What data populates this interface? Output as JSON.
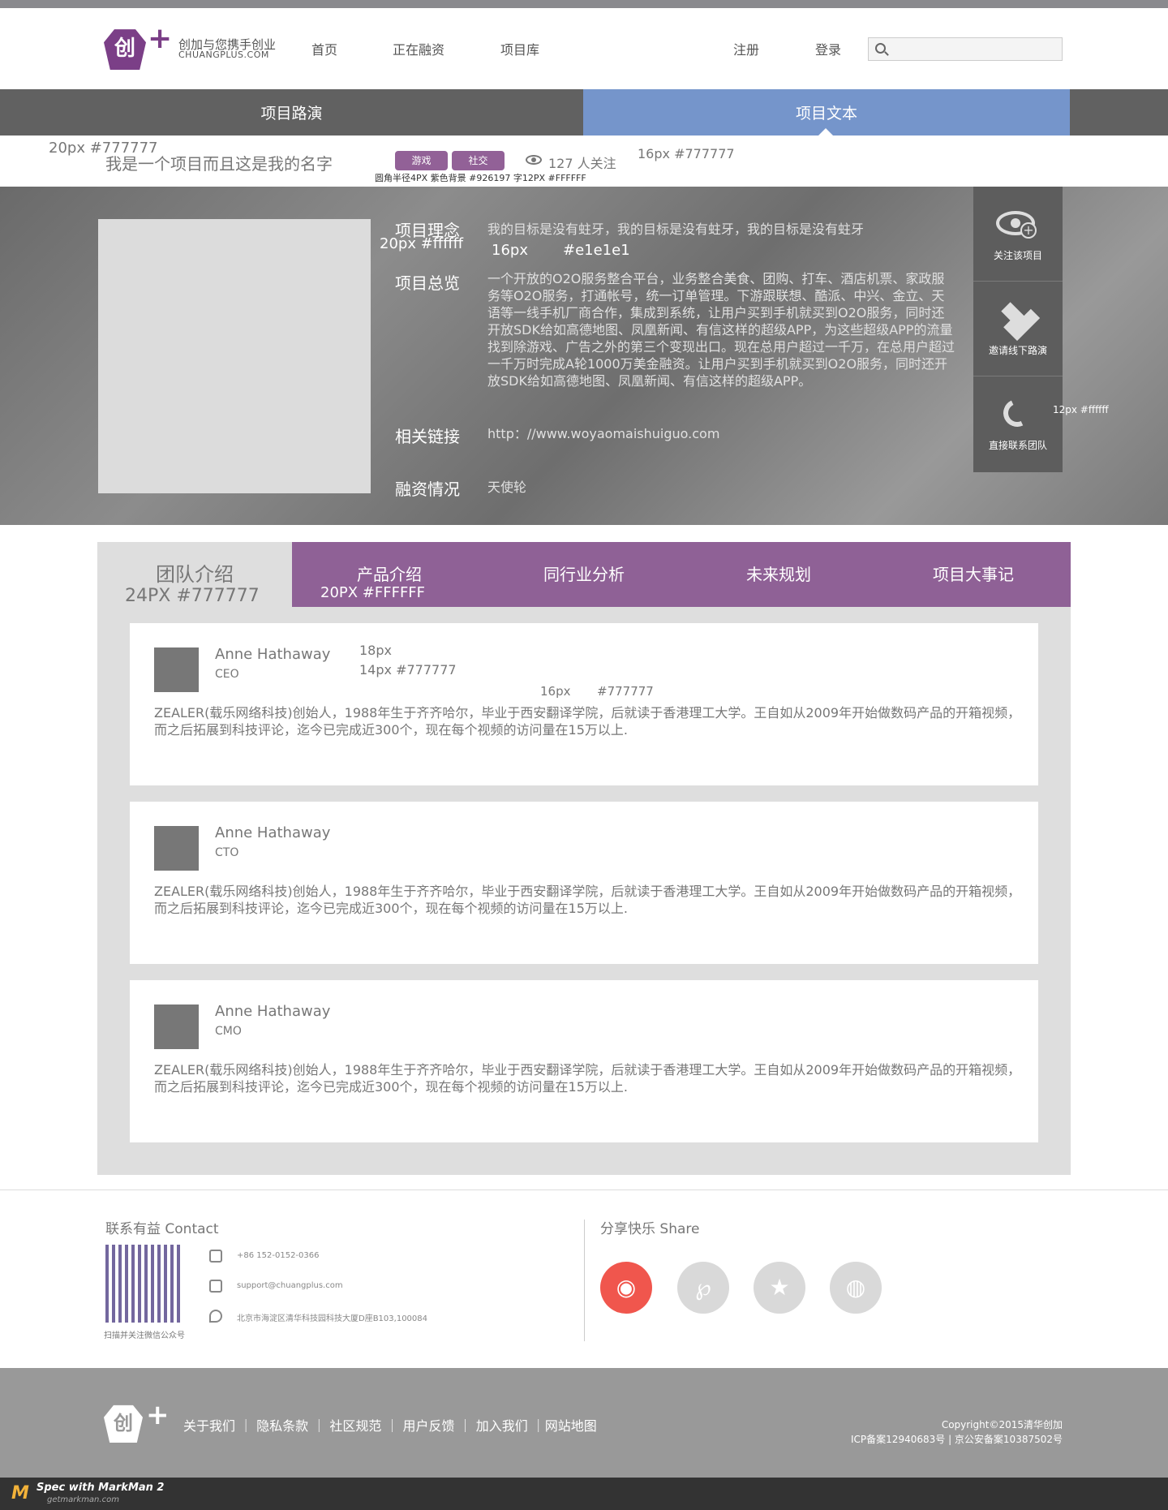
{
  "header": {
    "logo_mark": "创",
    "logo_plus": "+",
    "tagline_cn": "创加与您携手创业",
    "tagline_en": "CHUANGPLUS.COM",
    "nav": [
      "首页",
      "正在融资",
      "项目库"
    ],
    "register": "注册",
    "login": "登录",
    "search_placeholder": ""
  },
  "tabs": {
    "roadshow": "项目路演",
    "text": "项目文本"
  },
  "project": {
    "name": "我是一个项目而且这是我的名字",
    "tags": [
      "游戏",
      "社交"
    ],
    "followers": "127 人关注"
  },
  "hero": {
    "labels": [
      "项目理念",
      "项目总览",
      "相关链接",
      "融资情况"
    ],
    "idea": "我的目标是没有蛀牙，我的目标是没有蛀牙，我的目标是没有蛀牙",
    "overview": "一个开放的O2O服务整合平台，业务整合美食、团购、打车、酒店机票、家政服务等O2O服务，打通帐号，统一订单管理。下游跟联想、酷派、中兴、金立、天语等一线手机厂商合作，集成到系统，让用户买到手机就买到O2O服务，同时还开放SDK给如高德地图、凤凰新闻、有信这样的超级APP，为这些超级APP的流量找到除游戏、广告之外的第三个变现出口。现在总用户超过一千万，在总用户超过一千万时完成A轮1000万美金融资。让用户买到手机就买到O2O服务，同时还开放SDK给如高德地图、凤凰新闻、有信这样的超级APP。",
    "link": "http：//www.woyaomaishuiguo.com",
    "funding": "天使轮"
  },
  "side": [
    "关注该项目",
    "邀请线下路演",
    "直接联系团队"
  ],
  "product_tabs": {
    "team": "团队介绍",
    "items": [
      "产品介绍",
      "同行业分析",
      "未来规划",
      "项目大事记"
    ]
  },
  "team": [
    {
      "name": "Anne Hathaway",
      "role": "CEO",
      "bio": "ZEALER(载乐网络科技)创始人，1988年生于齐齐哈尔，毕业于西安翻译学院，后就读于香港理工大学。王自如从2009年开始做数码产品的开箱视频，而之后拓展到科技评论，迄今已完成近300个，现在每个视频的访问量在15万以上."
    },
    {
      "name": "Anne Hathaway",
      "role": "CTO",
      "bio": "ZEALER(载乐网络科技)创始人，1988年生于齐齐哈尔，毕业于西安翻译学院，后就读于香港理工大学。王自如从2009年开始做数码产品的开箱视频，而之后拓展到科技评论，迄今已完成近300个，现在每个视频的访问量在15万以上."
    },
    {
      "name": "Anne Hathaway",
      "role": "CMO",
      "bio": "ZEALER(载乐网络科技)创始人，1988年生于齐齐哈尔，毕业于西安翻译学院，后就读于香港理工大学。王自如从2009年开始做数码产品的开箱视频，而之后拓展到科技评论，迄今已完成近300个，现在每个视频的访问量在15万以上."
    }
  ],
  "footer": {
    "contact_title": "联系有益 Contact",
    "qr_caption": "扫描并关注微信公众号",
    "phone": "+86 152-0152-0366",
    "email": "support@chuangplus.com",
    "address": "北京市海淀区清华科技园科技大厦D座B103,100084",
    "share_title": "分享快乐 Share",
    "links": "关于我们 ｜ 隐私条款 ｜ 社区规范 ｜ 用户反馈 ｜ 加入我们 ｜网站地图",
    "copyright": "Copyright©2015清华创加",
    "icp": "ICP备案12940683号 | 京公安备案10387502号"
  },
  "annotations": {
    "a1": "20px #777777",
    "a2": "圆角半径4PX 紫色背景 #926197 字12PX #FFFFFF",
    "a3": "16px #777777",
    "a4": "20px #ffffff",
    "a5": "16px",
    "a6": "#e1e1e1",
    "a7": "12px #ffffff",
    "a8": "24PX #777777",
    "a9": "20PX #FFFFFF",
    "a10": "18px",
    "a11": "14px #777777",
    "a12": "16px",
    "a13": "#777777"
  },
  "markman": {
    "title": "Spec with MarkMan 2",
    "site": "getmarkman.com",
    "logo": "M"
  }
}
